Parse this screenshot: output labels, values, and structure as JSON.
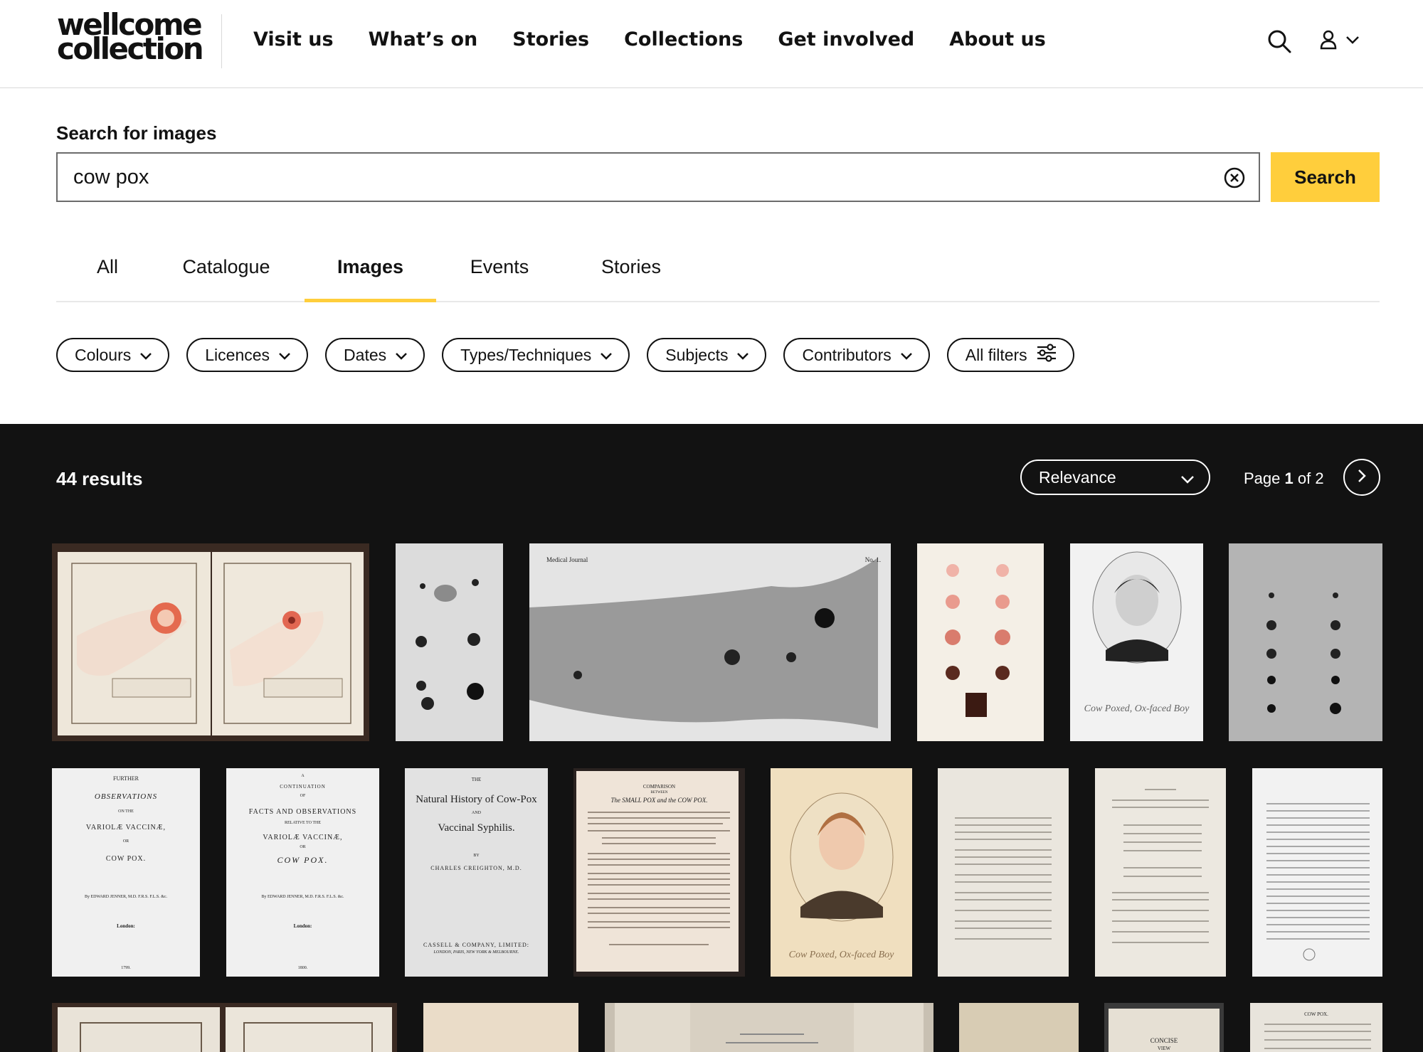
{
  "header": {
    "logo_line1": "wellcome",
    "logo_line2": "collection",
    "nav": [
      "Visit us",
      "What’s on",
      "Stories",
      "Collections",
      "Get involved",
      "About us"
    ]
  },
  "search": {
    "heading": "Search for images",
    "value": "cow pox",
    "button_label": "Search"
  },
  "tabs": [
    {
      "label": "All",
      "active": false
    },
    {
      "label": "Catalogue",
      "active": false
    },
    {
      "label": "Images",
      "active": true
    },
    {
      "label": "Events",
      "active": false
    },
    {
      "label": "Stories",
      "active": false
    }
  ],
  "filters": [
    "Colours",
    "Licences",
    "Dates",
    "Types/Techniques",
    "Subjects",
    "Contributors",
    "All filters"
  ],
  "results": {
    "count_label": "44 results",
    "sort_value": "Relevance",
    "page_prefix": "Page",
    "page_current": "1",
    "page_of": "of 2"
  },
  "thumbnails": {
    "t3_left": "Medical Journal",
    "t3_right": "No. 1.",
    "t5_caption": "Cow Poxed, Ox-faced Boy",
    "b1": [
      "FURTHER",
      "OBSERVATIONS",
      "ON THE",
      "VARIOLÆ VACCINÆ,",
      "OR",
      "COW POX.",
      "By EDWARD JENNER, M.D. F.R.S. F.L.S. &c.",
      "London:",
      "1799."
    ],
    "b2": [
      "A",
      "CONTINUATION",
      "OF",
      "FACTS AND OBSERVATIONS",
      "RELATIVE TO THE",
      "VARIOLÆ VACCINÆ,",
      "OR",
      "COW POX.",
      "By EDWARD JENNER, M.D. F.R.S. F.L.S. &c.",
      "London:",
      "1800."
    ],
    "b3": [
      "THE",
      "Natural History of Cow-Pox",
      "AND",
      "Vaccinal Syphilis.",
      "BY",
      "CHARLES CREIGHTON, M.D.",
      "CASSELL & COMPANY, LIMITED:",
      "LONDON, PARIS, NEW YORK & MELBOURNE."
    ],
    "b4": [
      "COMPARISON",
      "BETWEEN",
      "The SMALL POX and the COW POX."
    ],
    "b5_caption": "Cow Poxed, Ox-faced Boy",
    "c5": [
      "CONCISE",
      "VIEW"
    ],
    "c6": [
      "COW POX."
    ]
  }
}
